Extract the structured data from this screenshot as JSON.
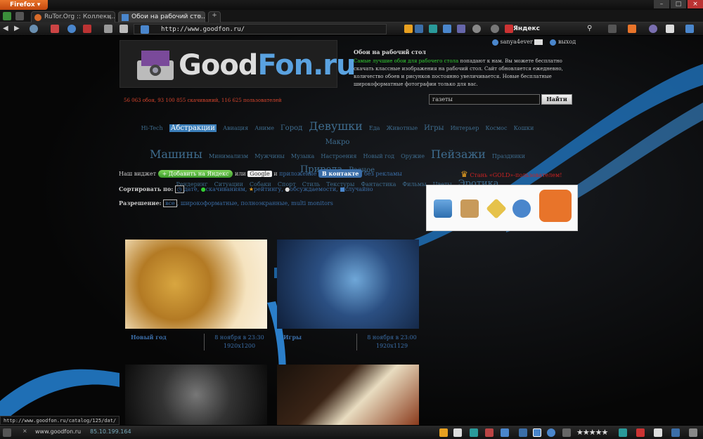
{
  "browser": {
    "app_button": "Firefox",
    "tabs": [
      {
        "label": "RuTor.Org :: Коллекц..."
      },
      {
        "label": "Обои на рабочий сто..."
      }
    ],
    "url": "http://www.goodfon.ru/",
    "search_engine": "Яндекс",
    "status_url": "http://www.goodfon.ru/catalog/125/dat/",
    "status_host": "www.goodfon.ru",
    "status_ip": "85.10.199.164"
  },
  "site": {
    "logo": {
      "good": "Good",
      "fon": "Fon.ru"
    },
    "user": {
      "name": "sanya4ever",
      "logout": "выход"
    },
    "intro": {
      "title": "Обои на рабочий стол",
      "highlight": "Самые лучшие обои для рабочего стола",
      "text": " попадают к нам. Вы можете бесплатно скачать классные изображения на рабочий стол. Сайт обновляется ежедневно, количество обоев и рисунков постоянно увеличивается. Новые бесплатные широкоформатные фотографии только для вас."
    },
    "stats": "56 063 обоя, 93 100 855 скачиваний, 116 625 пользователей",
    "search": {
      "value": "газеты",
      "button": "Найти"
    },
    "cloud_rows": [
      [
        {
          "t": "Hi-Tech",
          "s": 1
        },
        {
          "t": "Абстракции",
          "s": 2,
          "hl": true
        },
        {
          "t": "Авиация",
          "s": 1
        },
        {
          "t": "Аниме",
          "s": 1
        },
        {
          "t": "Город",
          "s": 2
        },
        {
          "t": "Девушки",
          "s": 4
        },
        {
          "t": "Еда",
          "s": 1
        },
        {
          "t": "Животные",
          "s": 1
        },
        {
          "t": "Игры",
          "s": 2
        },
        {
          "t": "Интерьер",
          "s": 1
        },
        {
          "t": "Космос",
          "s": 1
        },
        {
          "t": "Кошки",
          "s": 1
        },
        {
          "t": "Макро",
          "s": 2
        }
      ],
      [
        {
          "t": "Машины",
          "s": 4
        },
        {
          "t": "Минимализм",
          "s": 1
        },
        {
          "t": "Мужчины",
          "s": 1
        },
        {
          "t": "Музыка",
          "s": 1
        },
        {
          "t": "Настроения",
          "s": 1
        },
        {
          "t": "Новый год",
          "s": 1
        },
        {
          "t": "Оружие",
          "s": 1
        },
        {
          "t": "Пейзажи",
          "s": 4
        },
        {
          "t": "Праздники",
          "s": 1
        },
        {
          "t": "Природа",
          "s": 3
        },
        {
          "t": "Разное",
          "s": 2
        }
      ],
      [
        {
          "t": "Рендеринг",
          "s": 1
        },
        {
          "t": "Ситуации",
          "s": 1
        },
        {
          "t": "Собаки",
          "s": 1
        },
        {
          "t": "Спорт",
          "s": 1
        },
        {
          "t": "Стиль",
          "s": 1
        },
        {
          "t": "Текстуры",
          "s": 1
        },
        {
          "t": "Фантастика",
          "s": 1
        },
        {
          "t": "Фильмы",
          "s": 1
        },
        {
          "t": "Цветы",
          "s": 1
        },
        {
          "t": "Эротика",
          "s": 3
        }
      ]
    ],
    "widget": {
      "label": "Наш виджет",
      "yandex": "+ Добавить на Яндекс",
      "or": "или",
      "google": "Google",
      "and": "и",
      "app": "приложение",
      "vk": "В контакте",
      "noads": "без рекламы"
    },
    "gold": "Стань «GOLD»-пользователем!",
    "sort": {
      "label": "Сортировать по:",
      "options": [
        "дате",
        "скачиваниям",
        "рейтингу",
        "обсуждаемости",
        "случайно"
      ]
    },
    "resolution": {
      "label": "Разрешение:",
      "options": [
        "все",
        "широкоформатные",
        "полноэкранные",
        "multi monitors"
      ]
    },
    "thumbnails": [
      {
        "category": "Новый год",
        "date": "8 ноября в 23:30",
        "size": "1920x1200"
      },
      {
        "category": "Игры",
        "date": "8 ноября в 23:00",
        "size": "1920x1129"
      },
      {
        "category": "",
        "date": "",
        "size": ""
      },
      {
        "category": "",
        "date": "",
        "size": ""
      }
    ]
  },
  "colors": {
    "brand_blue": "#5aa2e0",
    "link": "#3b6ea8",
    "stats_red": "#d8452d",
    "firefox_orange": "#e8742a"
  }
}
